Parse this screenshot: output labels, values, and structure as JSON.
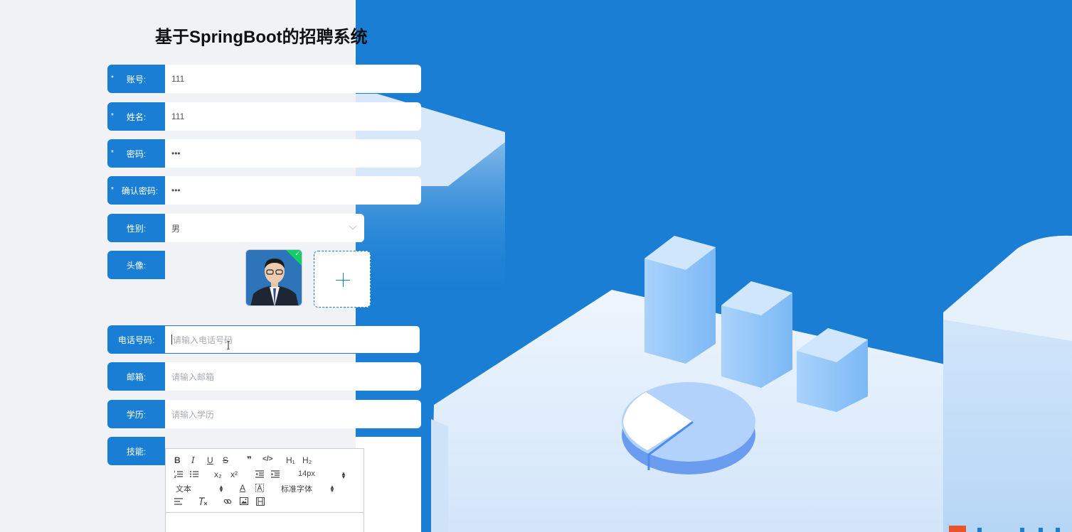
{
  "page": {
    "title": "基于SpringBoot的招聘系统"
  },
  "form": {
    "account": {
      "label": "账号:",
      "value": "111",
      "required": "*"
    },
    "name": {
      "label": "姓名:",
      "value": "111",
      "required": "*"
    },
    "password": {
      "label": "密码:",
      "value": "•••",
      "required": "*"
    },
    "confirm_password": {
      "label": "确认密码:",
      "value": "•••",
      "required": "*"
    },
    "gender": {
      "label": "性别:",
      "value": "男"
    },
    "avatar": {
      "label": "头像:"
    },
    "phone": {
      "label": "电话号码:",
      "placeholder": "请输入电话号码"
    },
    "email": {
      "label": "邮箱:",
      "placeholder": "请输入邮箱"
    },
    "education": {
      "label": "学历:",
      "placeholder": "请输入学历"
    },
    "skills": {
      "label": "技能:"
    }
  },
  "editor": {
    "toolbar_row1": [
      "B",
      "I",
      "U",
      "S",
      "❞",
      "</>",
      "H₁",
      "H₂"
    ],
    "sub": "x₂",
    "sup": "x²",
    "font_size": "14px",
    "text_type": "文本",
    "font_family": "标准字体",
    "font_color_icon": "A"
  },
  "icons": {
    "plus": "plus-icon",
    "chevron": "chevron-down-icon",
    "check": "check-icon"
  },
  "colors": {
    "primary": "#1a7fd4",
    "success": "#13ce66",
    "background": "#f0f2f5"
  }
}
